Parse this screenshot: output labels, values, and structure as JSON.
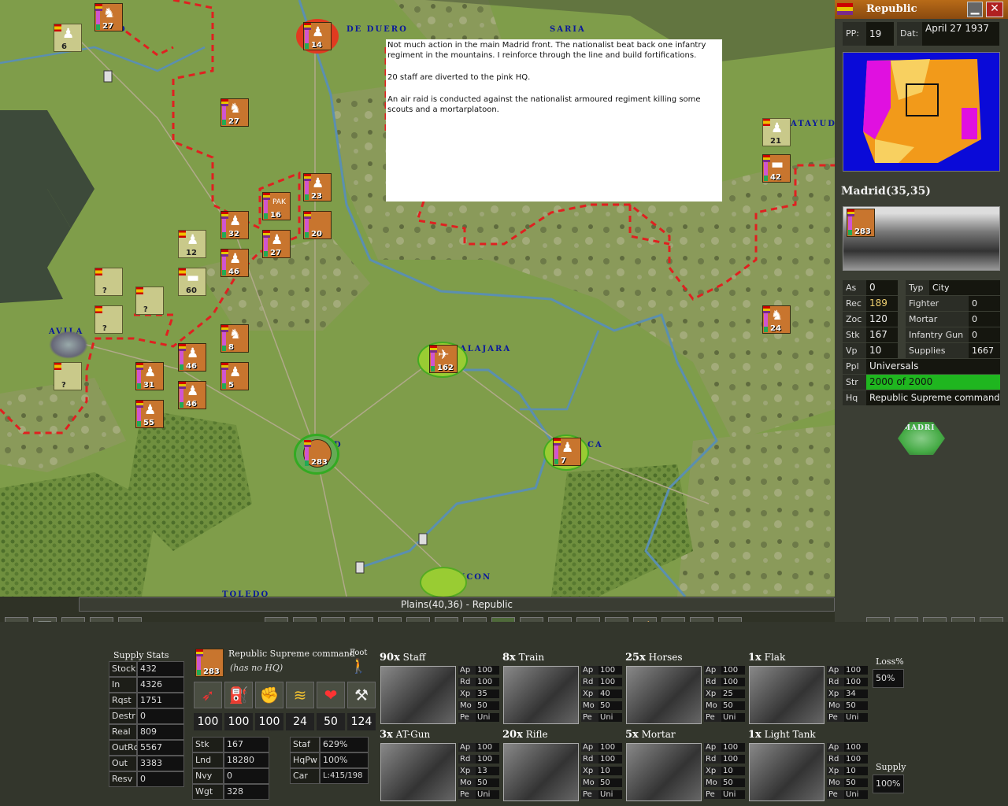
{
  "message": {
    "paragraphs": [
      "Not much action in the main Madrid front. The nationalist beat back one infantry regiment in the mountains. I reinforce through the line and build fortifications.",
      "20 staff are diverted to the pink HQ.",
      "An air raid is conducted against the nationalist armoured regiment killing some scouts and a mortarplatoon."
    ]
  },
  "map": {
    "status": "Plains(40,36) - Republic",
    "cities": [
      {
        "name": "D",
        "pos": "a"
      },
      {
        "name": "DE DUERO",
        "pos": "b"
      },
      {
        "name": "SARIA",
        "pos": "c"
      },
      {
        "name": "AVILA",
        "pos": "d"
      },
      {
        "name": "ALAJARA",
        "pos": "e"
      },
      {
        "name": "D",
        "pos": "f"
      },
      {
        "name": "CA",
        "pos": "g"
      },
      {
        "name": "TORONCON",
        "pos": "h"
      },
      {
        "name": "ATAYUD",
        "pos": "i"
      },
      {
        "name": "TOLEDO",
        "pos": "j"
      }
    ],
    "units": [
      {
        "id": "u1",
        "n": "27"
      },
      {
        "id": "u2",
        "n": "6"
      },
      {
        "id": "u3",
        "n": "14"
      },
      {
        "id": "u4",
        "n": "27"
      },
      {
        "id": "u5",
        "n": "23"
      },
      {
        "id": "u6",
        "n": "16",
        "lbl": "PAK"
      },
      {
        "id": "u7",
        "n": "20"
      },
      {
        "id": "u8",
        "n": "32"
      },
      {
        "id": "u9",
        "n": "27"
      },
      {
        "id": "u10",
        "n": "12"
      },
      {
        "id": "u11",
        "n": "46"
      },
      {
        "id": "u12",
        "n": "60"
      },
      {
        "id": "u13",
        "n": "?"
      },
      {
        "id": "u14",
        "n": "?"
      },
      {
        "id": "u15",
        "n": "?"
      },
      {
        "id": "u16",
        "n": "?"
      },
      {
        "id": "u17",
        "n": "8"
      },
      {
        "id": "u18",
        "n": "46"
      },
      {
        "id": "u19",
        "n": "31"
      },
      {
        "id": "u20",
        "n": "5"
      },
      {
        "id": "u21",
        "n": "46"
      },
      {
        "id": "u22",
        "n": "55"
      },
      {
        "id": "u23",
        "n": "162"
      },
      {
        "id": "u24",
        "n": "283"
      },
      {
        "id": "u25",
        "n": "7"
      },
      {
        "id": "u26",
        "n": "21"
      },
      {
        "id": "u27",
        "n": "42"
      },
      {
        "id": "u28",
        "n": "24"
      }
    ]
  },
  "side_panel": {
    "title": "Republic",
    "pp_label": "PP:",
    "pp_value": "19",
    "date_label": "Dat:",
    "date_value": "April 27 1937",
    "location": "Madrid(35,35)",
    "hex_unit_count": "283",
    "stats_left": [
      {
        "k": "As",
        "v": "0"
      },
      {
        "k": "Rec",
        "v": "189"
      },
      {
        "k": "Zoc",
        "v": "120"
      },
      {
        "k": "Stk",
        "v": "167"
      },
      {
        "k": "Vp",
        "v": "10"
      }
    ],
    "stats_right": [
      {
        "k": "Typ",
        "v": "City"
      },
      {
        "k": "Fighter",
        "v": "0"
      },
      {
        "k": "Mortar",
        "v": "0"
      },
      {
        "k": "Infantry Gun",
        "v": "0"
      },
      {
        "k": "Supplies",
        "v": "1667"
      }
    ],
    "ppl_label": "Ppl",
    "ppl_value": "Universals",
    "str_label": "Str",
    "str_value": "2000 of 2000",
    "str_fill": 1.0,
    "hq_label": "Hq",
    "hq_value": "Republic Supreme command",
    "mini_hex": "MADRI"
  },
  "supply_stats": {
    "title": "Supply Stats",
    "rows": [
      {
        "k": "Stock",
        "v": "432"
      },
      {
        "k": "In",
        "v": "4326"
      },
      {
        "k": "Rqst",
        "v": "1751"
      },
      {
        "k": "Destr",
        "v": "0"
      },
      {
        "k": "Real",
        "v": "809"
      },
      {
        "k": "OutRq",
        "v": "5567"
      },
      {
        "k": "Out",
        "v": "3383"
      },
      {
        "k": "Resv",
        "v": "0"
      }
    ]
  },
  "unit_detail": {
    "name": "Republic Supreme command",
    "hq": "(has no HQ)",
    "move_type": "Foot",
    "count": "283",
    "meters": [
      "100",
      "100",
      "100",
      "24",
      "50",
      "124"
    ],
    "stats_a": [
      {
        "k": "Stk",
        "v": "167"
      },
      {
        "k": "Lnd",
        "v": "18280"
      },
      {
        "k": "Nvy",
        "v": "0"
      },
      {
        "k": "Wgt",
        "v": "328"
      }
    ],
    "stats_b": [
      {
        "k": "Staf",
        "v": "629%"
      },
      {
        "k": "HqPw",
        "v": "100%"
      },
      {
        "k": "Car",
        "v": "L:415/198"
      }
    ]
  },
  "equipment": [
    {
      "qty": "90x",
      "name": "Staff",
      "ap": "100",
      "rd": "100",
      "xp": "35",
      "mo": "50",
      "pe": "Uni"
    },
    {
      "qty": "8x",
      "name": "Train",
      "ap": "100",
      "rd": "100",
      "xp": "40",
      "mo": "50",
      "pe": "Uni"
    },
    {
      "qty": "25x",
      "name": "Horses",
      "ap": "100",
      "rd": "100",
      "xp": "25",
      "mo": "50",
      "pe": "Uni"
    },
    {
      "qty": "1x",
      "name": "Flak",
      "ap": "100",
      "rd": "100",
      "xp": "34",
      "mo": "50",
      "pe": "Uni"
    },
    {
      "qty": "3x",
      "name": "AT-Gun",
      "ap": "100",
      "rd": "100",
      "xp": "13",
      "mo": "50",
      "pe": "Uni"
    },
    {
      "qty": "20x",
      "name": "Rifle",
      "ap": "100",
      "rd": "100",
      "xp": "10",
      "mo": "50",
      "pe": "Uni"
    },
    {
      "qty": "5x",
      "name": "Mortar",
      "ap": "100",
      "rd": "100",
      "xp": "10",
      "mo": "50",
      "pe": "Uni"
    },
    {
      "qty": "1x",
      "name": "Light Tank",
      "ap": "100",
      "rd": "100",
      "xp": "10",
      "mo": "50",
      "pe": "Uni"
    }
  ],
  "stat_keys": {
    "ap": "Ap",
    "rd": "Rd",
    "xp": "Xp",
    "mo": "Mo",
    "pe": "Pe"
  },
  "loss": {
    "label": "Loss%",
    "value": "50%"
  },
  "supply": {
    "label": "Supply",
    "value": "100%"
  }
}
